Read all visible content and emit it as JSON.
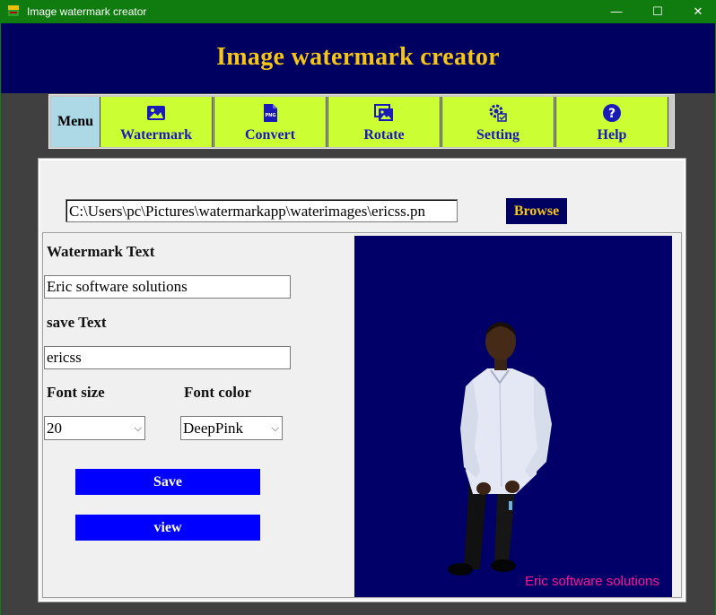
{
  "window": {
    "title": "Image watermark creator",
    "minimize_glyph": "—",
    "maximize_glyph": "☐",
    "close_glyph": "✕"
  },
  "header": {
    "heading": "Image watermark creator"
  },
  "menu": {
    "label": "Menu",
    "items": [
      {
        "label": "Watermark",
        "icon": "image-icon"
      },
      {
        "label": "Convert",
        "icon": "png-file-icon"
      },
      {
        "label": "Rotate",
        "icon": "images-icon"
      },
      {
        "label": "Setting",
        "icon": "gear-icon"
      },
      {
        "label": "Help",
        "icon": "help-icon"
      }
    ]
  },
  "file": {
    "path": "C:\\Users\\pc\\Pictures\\watermarkapp\\waterimages\\ericss.pn",
    "browse_label": "Browse"
  },
  "form": {
    "watermark_text_label": "Watermark Text",
    "watermark_text_value": "Eric software solutions",
    "save_text_label": "save Text",
    "save_text_value": "ericss",
    "font_size_label": "Font size",
    "font_size_value": "20",
    "font_color_label": "Font color",
    "font_color_value": "DeepPink",
    "save_button": "Save",
    "view_button": "view"
  },
  "preview": {
    "watermark": "Eric software solutions",
    "background_color": "#000068",
    "watermark_color": "#ff1493"
  },
  "colors": {
    "titlebar": "#107c10",
    "header_bg": "#000060",
    "header_text": "#f5c518",
    "menu_bg": "#ccff33",
    "menu_text": "#1a1ab8",
    "button_blue": "#0000ff"
  }
}
